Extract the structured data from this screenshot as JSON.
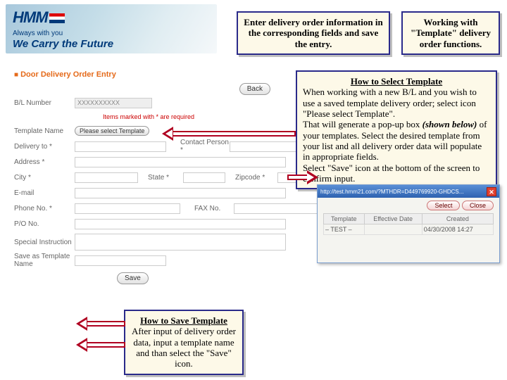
{
  "brand": {
    "name": "HMM",
    "tagline_small": "Always with you",
    "tagline_big": "We Carry the Future"
  },
  "callouts": {
    "enter_info": "Enter delivery order information in the corresponding fields and save the entry.",
    "working_with": "Working with \"Template\" delivery order functions.",
    "howto_select_title": "How to Select Template",
    "howto_select_body_1": "When working with a new B/L and you wish to use a saved template delivery order; select icon \"Please select Template\".",
    "howto_select_body_2": "That will generate a pop-up box ",
    "howto_select_body_2_em": "(shown below)",
    "howto_select_body_2b": " of your templates. Select the desired template from your list and all delivery order data will populate in appropriate fields.",
    "howto_select_body_3": "Select \"Save\" icon at the bottom of the screen to confirm input.",
    "howto_save_title": "How to Save Template",
    "howto_save_body": "After input of delivery order data, input a template name and than select the \"Save\" icon."
  },
  "form": {
    "page_title": "Door Delivery Order Entry",
    "back_btn": "Back",
    "bl_label": "B/L Number",
    "bl_value": "XXXXXXXXXX",
    "required_note": "Items marked with * are required",
    "template_name_label": "Template Name",
    "template_select_btn": "Please select Template",
    "delivery_to_label": "Delivery to *",
    "contact_person_label": "Contact Person *",
    "address_label": "Address *",
    "city_label": "City *",
    "state_label": "State *",
    "zipcode_label": "Zipcode *",
    "email_label": "E-mail",
    "phone_label": "Phone No. *",
    "fax_label": "FAX No.",
    "po_label": "P/O No.",
    "special_label": "Special Instruction",
    "save_as_label": "Save as Template Name",
    "save_btn": "Save"
  },
  "popup": {
    "url": "http://test.hmm21.com/?MTHDR=D449769920-GHDCS...",
    "select_btn": "Select",
    "close_btn": "Close",
    "cols": [
      "Template",
      "Effective Date",
      "Created"
    ],
    "row_template": "– TEST –",
    "row_eff": "",
    "row_created": "04/30/2008 14:27"
  }
}
